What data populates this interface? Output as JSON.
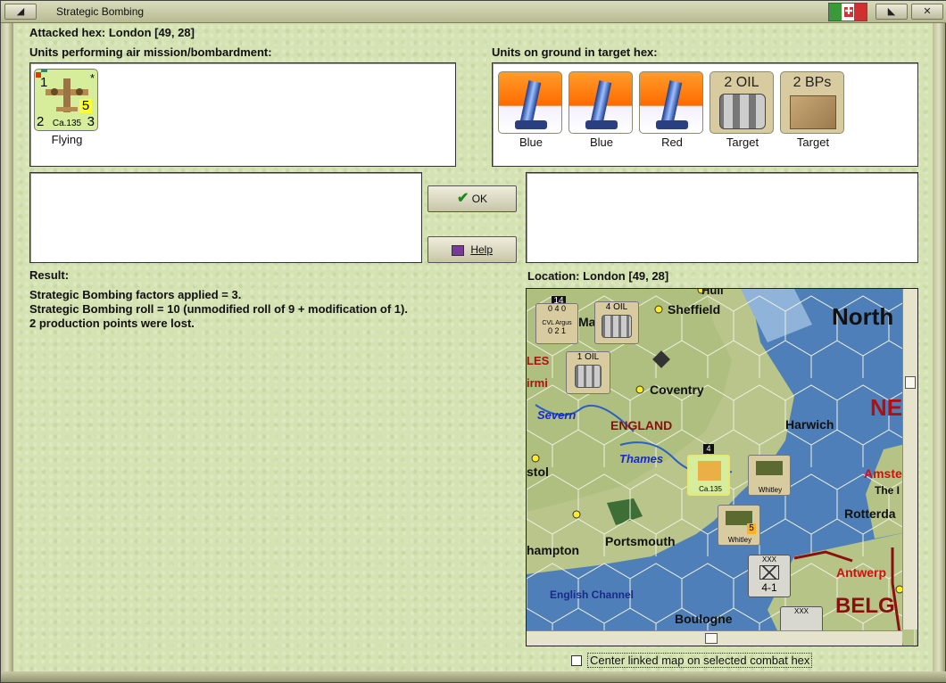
{
  "window": {
    "title": "Strategic Bombing"
  },
  "header": {
    "attacked_hex": "Attacked hex: London  [49, 28]"
  },
  "air_units": {
    "label": "Units performing air mission/bombardment:",
    "units": [
      {
        "name": "Ca.135",
        "status": "Flying",
        "top_left": "1",
        "bottom_left": "2",
        "bottom_right": "3",
        "highlight": "5",
        "mark": "*"
      }
    ]
  },
  "ground_units": {
    "label": "Units on ground in target hex:",
    "units": [
      {
        "type": "aa",
        "caption": "Blue"
      },
      {
        "type": "aa",
        "caption": "Blue"
      },
      {
        "type": "aa",
        "caption": "Red"
      },
      {
        "type": "oil",
        "header": "2 OIL",
        "caption": "Target"
      },
      {
        "type": "bp",
        "header": "2 BPs",
        "caption": "Target"
      }
    ]
  },
  "buttons": {
    "ok": "OK",
    "help": "Help"
  },
  "result": {
    "label": "Result:",
    "lines": [
      "Strategic Bombing factors applied = 3.",
      "Strategic Bombing roll = 10 (unmodified roll of 9 + modification of 1).",
      "2 production points were lost."
    ]
  },
  "location": {
    "label": "Location:  London  [49, 28]"
  },
  "map": {
    "places": {
      "north": "North",
      "sheffield": "Sheffield",
      "coventry": "Coventry",
      "severn": "Severn",
      "england": "ENGLAND",
      "harwich": "Harwich",
      "thames": "Thames",
      "ne": "NE",
      "amst": "Amste",
      "the": "The I",
      "stol": "stol",
      "rotterdam": "Rotterda",
      "portsmouth": "Portsmouth",
      "hampton": "hampton",
      "antwerp": "Antwerp",
      "channel": "English Channel",
      "boulogne": "Boulogne",
      "belg": "BELG",
      "les": "LES",
      "birm": "irmi",
      "hull": "Hull",
      "man": "Ma"
    },
    "counters": {
      "argus_name": "CVL Argus",
      "argus_top": "0  4  0",
      "argus_bottom": "0  2  1",
      "argus_stack": "14",
      "oil4": "4 OIL",
      "oil1": "1 OIL",
      "ca135": "Ca.135",
      "stack4": "4",
      "whitley": "Whitley",
      "whitley_factor": "5",
      "corps_factors": "4-1",
      "corps_size": "XXX"
    }
  },
  "footer": {
    "center_checkbox_label": "Center linked map on selected combat hex",
    "center_checkbox_checked": false
  },
  "colors": {
    "background": "#d5e3b3",
    "aa_orange": "#ff6a00",
    "plane_green": "#d6ee9c"
  }
}
